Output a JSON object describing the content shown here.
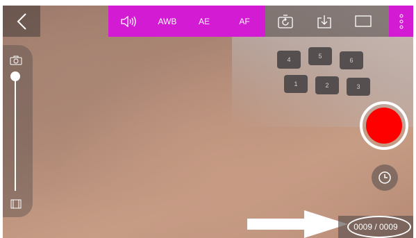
{
  "toolbar": {
    "awb_label": "AWB",
    "ae_label": "AE",
    "af_label": "AF"
  },
  "counter": {
    "text": "0009 / 0009"
  },
  "keyboard": {
    "keys": [
      "4",
      "5",
      "6",
      "1",
      "2",
      "3"
    ]
  },
  "icons": {
    "back": "chevron-left-icon",
    "sound": "speaker-icon",
    "rotate": "rotate-camera-icon",
    "download": "download-icon",
    "frame": "frame-icon",
    "menu": "vertical-dots-icon",
    "camera": "camera-icon",
    "film": "film-icon",
    "timer": "clock-icon"
  },
  "colors": {
    "toolbar_accent": "#d21bd2",
    "record": "#ff0000"
  }
}
